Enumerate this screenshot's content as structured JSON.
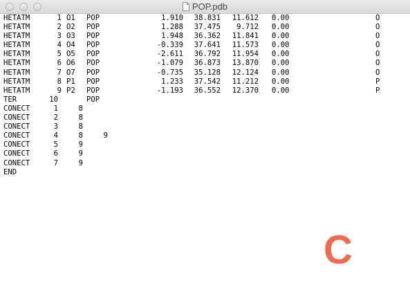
{
  "window": {
    "title": "POP.pdb"
  },
  "icons": {
    "title_icon": "document-icon",
    "traffic": [
      "close-icon",
      "minimize-icon",
      "zoom-icon"
    ]
  },
  "colors": {
    "overlay_letter": "#f26a4b"
  },
  "hetatm": [
    {
      "record": "HETATM",
      "serial": "1",
      "name": "O1",
      "resname": "POP",
      "x": "1.910",
      "y": "38.831",
      "z": "11.612",
      "occ": "0.00",
      "element": "O"
    },
    {
      "record": "HETATM",
      "serial": "2",
      "name": "O2",
      "resname": "POP",
      "x": "1.288",
      "y": "37.475",
      "z": "9.712",
      "occ": "0.00",
      "element": "O"
    },
    {
      "record": "HETATM",
      "serial": "3",
      "name": "O3",
      "resname": "POP",
      "x": "1.948",
      "y": "36.362",
      "z": "11.841",
      "occ": "0.00",
      "element": "O"
    },
    {
      "record": "HETATM",
      "serial": "4",
      "name": "O4",
      "resname": "POP",
      "x": "-0.339",
      "y": "37.641",
      "z": "11.573",
      "occ": "0.00",
      "element": "O"
    },
    {
      "record": "HETATM",
      "serial": "5",
      "name": "O5",
      "resname": "POP",
      "x": "-2.611",
      "y": "36.792",
      "z": "11.954",
      "occ": "0.00",
      "element": "O"
    },
    {
      "record": "HETATM",
      "serial": "6",
      "name": "O6",
      "resname": "POP",
      "x": "-1.079",
      "y": "36.873",
      "z": "13.870",
      "occ": "0.00",
      "element": "O"
    },
    {
      "record": "HETATM",
      "serial": "7",
      "name": "O7",
      "resname": "POP",
      "x": "-0.735",
      "y": "35.128",
      "z": "12.124",
      "occ": "0.00",
      "element": "O"
    },
    {
      "record": "HETATM",
      "serial": "8",
      "name": "P1",
      "resname": "POP",
      "x": "1.233",
      "y": "37.542",
      "z": "11.212",
      "occ": "0.00",
      "element": "P"
    },
    {
      "record": "HETATM",
      "serial": "9",
      "name": "P2",
      "resname": "POP",
      "x": "-1.193",
      "y": "36.552",
      "z": "12.370",
      "occ": "0.00",
      "element": "P"
    }
  ],
  "ter": {
    "record": "TER",
    "serial": "10",
    "resname": "POP"
  },
  "conect": [
    {
      "record": "CONECT",
      "a": "1",
      "b": "8",
      "c": ""
    },
    {
      "record": "CONECT",
      "a": "2",
      "b": "8",
      "c": ""
    },
    {
      "record": "CONECT",
      "a": "3",
      "b": "8",
      "c": ""
    },
    {
      "record": "CONECT",
      "a": "4",
      "b": "8",
      "c": "9"
    },
    {
      "record": "CONECT",
      "a": "5",
      "b": "9",
      "c": ""
    },
    {
      "record": "CONECT",
      "a": "6",
      "b": "9",
      "c": ""
    },
    {
      "record": "CONECT",
      "a": "7",
      "b": "9",
      "c": ""
    }
  ],
  "end": {
    "record": "END"
  },
  "overlay": {
    "letter": "C"
  }
}
